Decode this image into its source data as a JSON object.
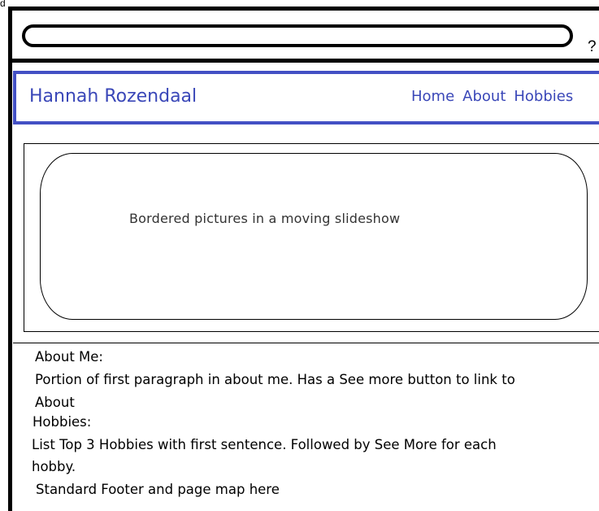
{
  "corner_mark": "d",
  "address_bar": {
    "value": ""
  },
  "help_label": "?",
  "header": {
    "brand": "Hannah Rozendaal",
    "nav": [
      {
        "label": "Home"
      },
      {
        "label": "About"
      },
      {
        "label": "Hobbies"
      }
    ]
  },
  "slideshow": {
    "placeholder_text": "Bordered pictures in a moving slideshow"
  },
  "about": {
    "heading": "About Me:",
    "line1": "Portion of first paragraph in about me. Has a See more button to link to",
    "line2": "About"
  },
  "hobbies": {
    "heading": "Hobbies:",
    "line1": "List Top 3 Hobbies with first sentence. Followed by See More for each",
    "line2": "hobby."
  },
  "footer": {
    "text": "Standard Footer and page map here"
  },
  "colors": {
    "accent": "#3a47b8",
    "nav_border": "#4350c4"
  }
}
